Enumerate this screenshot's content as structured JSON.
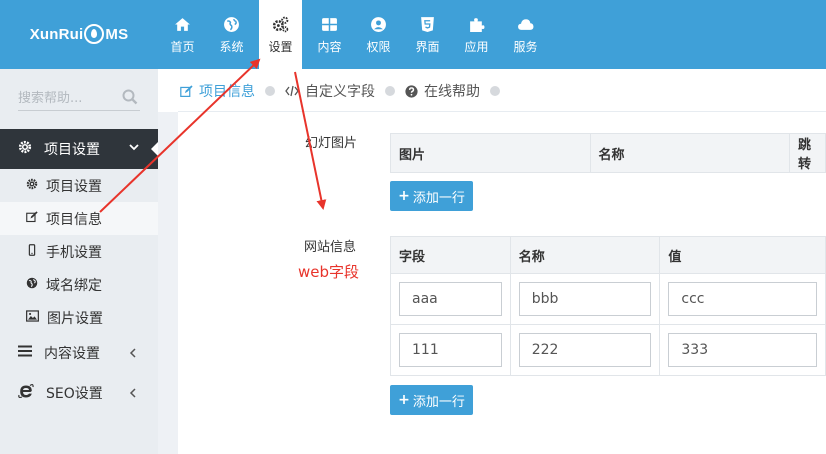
{
  "logo": {
    "prefix": "XunRui",
    "suffix": "MS"
  },
  "nav": [
    {
      "label": "首页",
      "icon": "home-icon"
    },
    {
      "label": "系统",
      "icon": "globe-icon"
    },
    {
      "label": "设置",
      "icon": "cogs-icon",
      "active": true
    },
    {
      "label": "内容",
      "icon": "grid-icon"
    },
    {
      "label": "权限",
      "icon": "user-icon"
    },
    {
      "label": "界面",
      "icon": "html5-icon"
    },
    {
      "label": "应用",
      "icon": "puzzle-icon"
    },
    {
      "label": "服务",
      "icon": "cloud-icon"
    }
  ],
  "sidebar": {
    "search_placeholder": "搜索帮助...",
    "head": "项目设置",
    "items": [
      {
        "label": "项目设置",
        "icon": "gear-icon"
      },
      {
        "label": "项目信息",
        "icon": "edit-icon"
      },
      {
        "label": "手机设置",
        "icon": "mobile-icon"
      },
      {
        "label": "域名绑定",
        "icon": "globe-icon"
      },
      {
        "label": "图片设置",
        "icon": "image-icon"
      }
    ],
    "groups": [
      {
        "label": "内容设置",
        "icon": "bars-icon"
      },
      {
        "label": "SEO设置",
        "icon": "ie-icon"
      }
    ]
  },
  "tabs": [
    {
      "label": "项目信息",
      "icon": "edit-icon"
    },
    {
      "label": "自定义字段",
      "icon": "code-icon"
    },
    {
      "label": "在线帮助",
      "icon": "question-icon"
    }
  ],
  "slides": {
    "label": "幻灯图片",
    "headers": [
      "图片",
      "名称",
      "跳转"
    ],
    "add_label": "添加一行"
  },
  "site": {
    "label": "网站信息",
    "note": "web字段",
    "headers": [
      "字段",
      "名称",
      "值"
    ],
    "rows": [
      [
        "aaa",
        "bbb",
        "ccc"
      ],
      [
        "111",
        "222",
        "333"
      ]
    ],
    "add_label": "添加一行"
  },
  "colors": {
    "primary": "#3fa0d8",
    "sidebar_dark": "#2f353b",
    "annotation": "#e8342b"
  }
}
